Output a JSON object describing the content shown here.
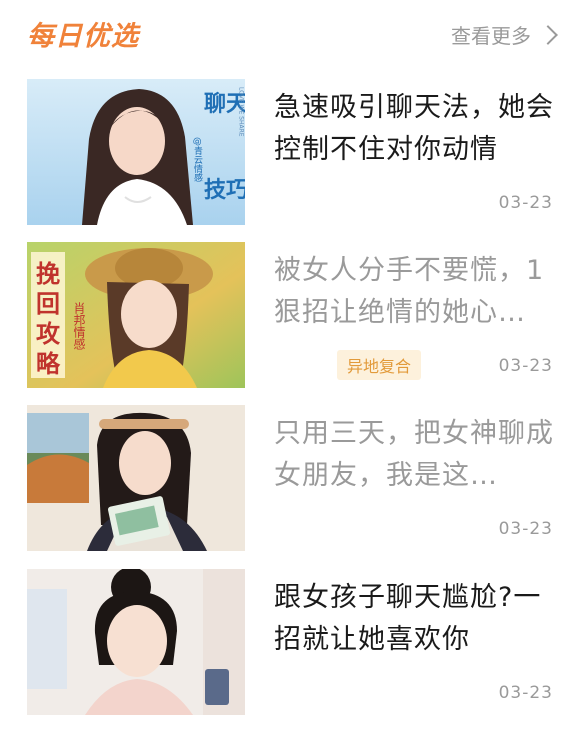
{
  "header": {
    "title": "每日优选",
    "more_label": "查看更多"
  },
  "articles": [
    {
      "title": "急速吸引聊天法，她会控制不住对你动情",
      "date": "03-23",
      "read": false,
      "thumb": {
        "line1": "聊天",
        "line2": "技巧",
        "small": "@青云情感",
        "small2": "LOVE WE SHARE"
      }
    },
    {
      "title": "被女人分手不要慌，1狠招让绝情的她心…",
      "date": "03-23",
      "read": true,
      "tag": "异地复合",
      "thumb": {
        "line1": "挽",
        "line2": "回",
        "line3": "攻",
        "line4": "略",
        "small": "肖邦情感"
      }
    },
    {
      "title": "只用三天，把女神聊成女朋友，我是这…",
      "date": "03-23",
      "read": true
    },
    {
      "title": "跟女孩子聊天尴尬?一招就让她喜欢你",
      "date": "03-23",
      "read": false
    }
  ]
}
